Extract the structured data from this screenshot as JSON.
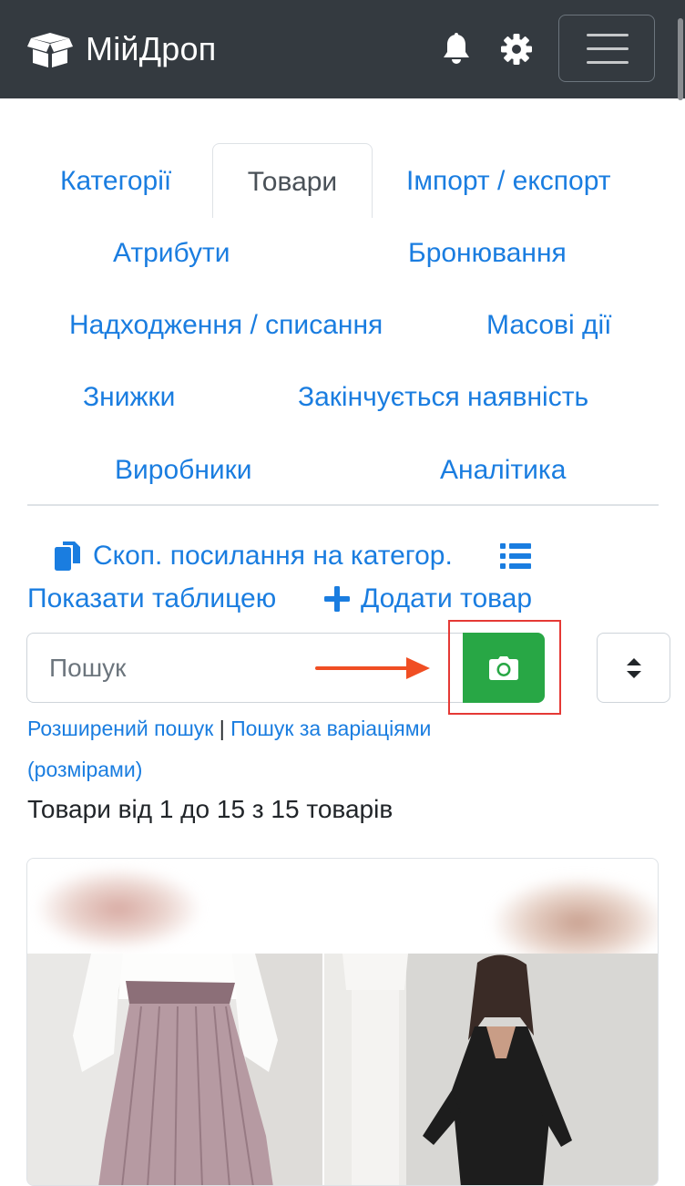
{
  "header": {
    "brand": "МійДроп",
    "icons": [
      "box-open-icon",
      "bell-icon",
      "gear-icon",
      "hamburger-icon"
    ],
    "background": "#343a40"
  },
  "tabs": [
    {
      "label": "Категорії",
      "active": false
    },
    {
      "label": "Товари",
      "active": true
    },
    {
      "label": "Імпорт / експорт",
      "active": false
    },
    {
      "label": "Атрибути",
      "active": false
    },
    {
      "label": "Бронювання",
      "active": false
    },
    {
      "label": "Надходження / списання",
      "active": false
    },
    {
      "label": "Масові дії",
      "active": false
    },
    {
      "label": "Знижки",
      "active": false
    },
    {
      "label": "Закінчується наявність",
      "active": false
    },
    {
      "label": "Виробники",
      "active": false
    },
    {
      "label": "Аналітика",
      "active": false
    }
  ],
  "actions": {
    "copy_link": "Скоп. посилання на категор.",
    "show_table": "Показати таблицею",
    "add_product": "Додати товар"
  },
  "search": {
    "placeholder": "Пошук",
    "value": "",
    "camera_icon": "camera-icon",
    "sort_icon": "sort-icon"
  },
  "links": {
    "advanced": "Розширений пошук",
    "separator": "|",
    "variations_1": "Пошук за варіаціями",
    "variations_2": "(розмірами)"
  },
  "results_text": "Товари від 1 до 15 з 15 товарів",
  "colors": {
    "link": "#1a7de0",
    "camera_button": "#28a745",
    "annotation": "#e53935",
    "arrow": "#f04e23"
  }
}
